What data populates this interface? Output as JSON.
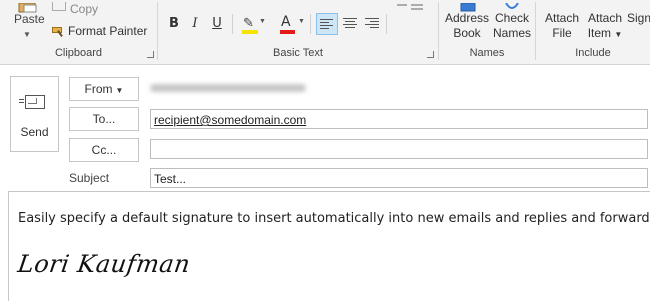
{
  "ribbon": {
    "clipboard": {
      "paste_label": "Paste",
      "copy_label": "Copy",
      "format_painter_label": "Format Painter",
      "group_label": "Clipboard"
    },
    "basic_text": {
      "bold_label": "B",
      "italic_label": "I",
      "underline_label": "U",
      "font_color_glyph": "A",
      "group_label": "Basic Text",
      "highlight_color": "#f5e400",
      "font_color": "#e31b1b"
    },
    "names": {
      "address_book_label": "Address\nBook",
      "check_names_label": "Check\nNames",
      "group_label": "Names"
    },
    "include": {
      "attach_file_label": "Attach\nFile",
      "attach_item_label": "Attach\nItem",
      "signature_label": "Signa",
      "group_label": "Include"
    }
  },
  "header": {
    "send_label": "Send",
    "from_label": "From",
    "to_label": "To...",
    "cc_label": "Cc...",
    "subject_label": "Subject",
    "to_value": "recipient@somedomain.com",
    "cc_value": "",
    "subject_value": "Test..."
  },
  "body": {
    "text": "Easily specify a default signature to insert automatically into new emails and replies and forwards.",
    "signature": "Lori Kaufman"
  },
  "colors": {
    "accent": "#cde6f7",
    "ribbon_bg": "#f3f3f3",
    "border": "#c6c6c6"
  }
}
